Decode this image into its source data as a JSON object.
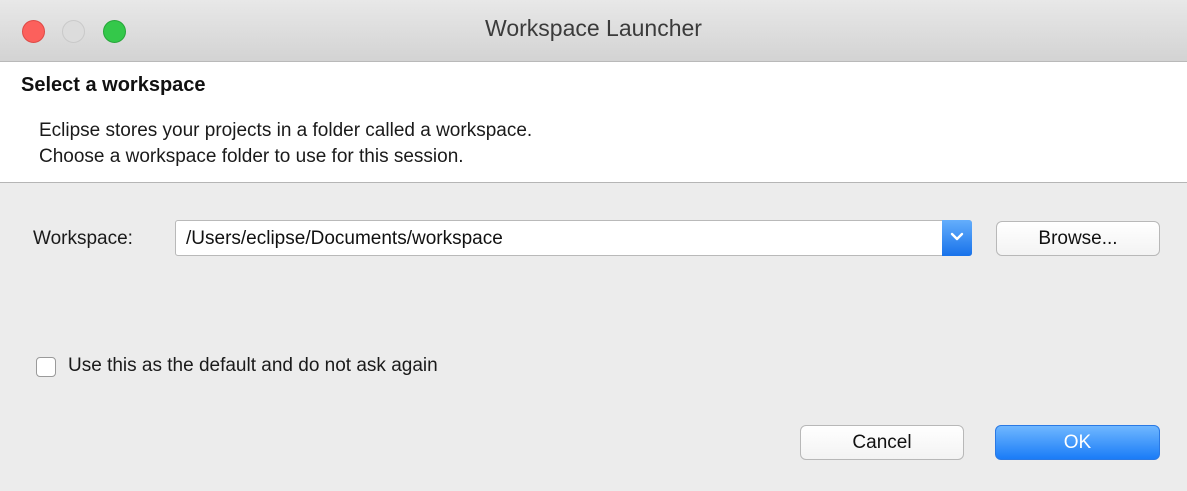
{
  "window": {
    "title": "Workspace Launcher"
  },
  "header": {
    "title": "Select a workspace",
    "description_line1": "Eclipse stores your projects in a folder called a workspace.",
    "description_line2": "Choose a workspace folder to use for this session."
  },
  "form": {
    "workspace_label": "Workspace:",
    "workspace_value": "/Users/eclipse/Documents/workspace",
    "browse_label": "Browse...",
    "default_checkbox_label": "Use this as the default and do not ask again",
    "default_checked": false
  },
  "footer": {
    "cancel_label": "Cancel",
    "ok_label": "OK"
  },
  "colors": {
    "close": "#fc605c",
    "minimize": "#dcdcdc",
    "maximize": "#34c84a",
    "accent": "#1a7cf7"
  },
  "icons": {
    "dropdown": "chevron-down-icon"
  }
}
